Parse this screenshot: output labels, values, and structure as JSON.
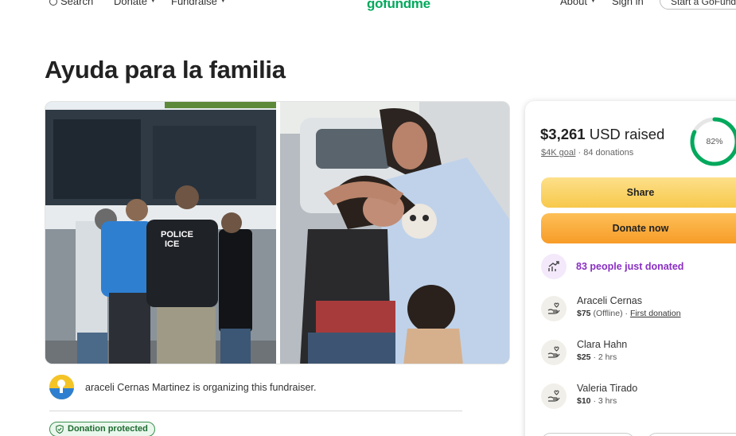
{
  "nav": {
    "search": "Search",
    "donate": "Donate",
    "fundraise": "Fundraise",
    "logo": "gofundme",
    "about": "About",
    "signin": "Sign in",
    "start": "Start a GoFundMe"
  },
  "campaign": {
    "title": "Ayuda para la familia",
    "hero_badge_line1": "POLICE",
    "hero_badge_line2": "ICE"
  },
  "organizer": {
    "text": "araceli Cernas Martinez is organizing this fundraiser."
  },
  "protected_label": "Donation protected",
  "card": {
    "raised_amount": "$3,261",
    "raised_rest": " USD raised",
    "goal": "$4K goal",
    "sep": " · ",
    "donations": "84 donations",
    "progress_label": "82%",
    "progress_fraction": 0.82,
    "share_label": "Share",
    "donate_label": "Donate now",
    "just_donated": "83 people just donated"
  },
  "donors": [
    {
      "name": "Araceli Cernas",
      "amount": "$75",
      "note": " (Offline) · ",
      "link": "First donation"
    },
    {
      "name": "Clara Hahn",
      "amount": "$25",
      "note": " · 2 hrs",
      "link": ""
    },
    {
      "name": "Valeria Tirado",
      "amount": "$10",
      "note": " · 3 hrs",
      "link": ""
    }
  ],
  "colors": {
    "brand": "#02a95c",
    "share": "#f7c84b",
    "donate": "#f79c28",
    "trend": "#8a2fc3",
    "protected": "#1e6b31"
  }
}
